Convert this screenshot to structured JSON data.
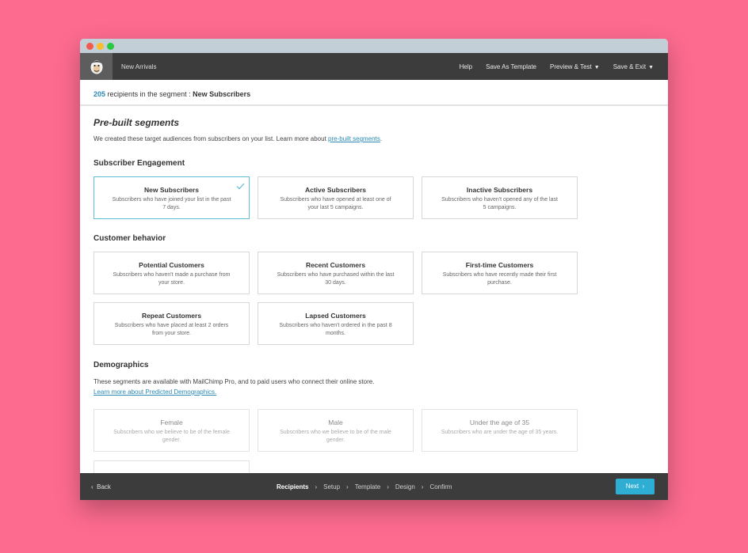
{
  "topbar": {
    "campaign_name": "New Arrivals",
    "actions": [
      "Help",
      "Save As Template",
      "Preview & Test",
      "Save & Exit"
    ]
  },
  "recipients": {
    "count": "205",
    "text": "recipients in the segment :",
    "segment": "New Subscribers"
  },
  "main": {
    "title": "Pre-built segments",
    "intro_text": "We created these target audiences from subscribers on your list. Learn more about",
    "intro_link": "pre-built segments",
    "intro_end": ".",
    "sections": {
      "engagement": "Subscriber Engagement",
      "behavior": "Customer behavior",
      "demographics": "Demographics"
    },
    "demo_text": "These segments are available with MailChimp Pro, and to paid users who connect their online store.",
    "demo_link": "Learn more about Predicted Demographics."
  },
  "cards": {
    "new_subscribers": {
      "title": "New Subscribers",
      "desc": "Subscribers who have joined your list in the past 7 days."
    },
    "active_subscribers": {
      "title": "Active Subscribers",
      "desc": "Subscribers who have opened at least one of your last 5 campaigns."
    },
    "inactive_subscribers": {
      "title": "Inactive Subscribers",
      "desc": "Subscribers who haven't opened any of the last 5 campaigns."
    },
    "potential_customers": {
      "title": "Potential Customers",
      "desc": "Subscribers who haven't made a purchase from your store."
    },
    "recent_customers": {
      "title": "Recent Customers",
      "desc": "Subscribers who have purchased within the last 30 days."
    },
    "first_time_customers": {
      "title": "First-time Customers",
      "desc": "Subscribers who have recently made their first purchase."
    },
    "repeat_customers": {
      "title": "Repeat Customers",
      "desc": "Subscribers who have placed at least 2 orders from your store."
    },
    "lapsed_customers": {
      "title": "Lapsed Customers",
      "desc": "Subscribers who haven't ordered in the past 8 months."
    },
    "female": {
      "title": "Female",
      "desc": "Subscribers who we believe to be of the female gender."
    },
    "male": {
      "title": "Male",
      "desc": "Subscribers who we believe to be of the male gender."
    },
    "under_35": {
      "title": "Under the age of 35",
      "desc": "Subscribers who are under the age of 35 years."
    }
  },
  "footer": {
    "back": "Back",
    "steps": [
      "Recipients",
      "Setup",
      "Template",
      "Design",
      "Confirm"
    ],
    "next": "Next"
  },
  "colors": {
    "background": "#fd6b8f",
    "accent": "#2b8ab3",
    "next_button": "#2eaed3",
    "dark_bar": "#3c3c3c"
  }
}
